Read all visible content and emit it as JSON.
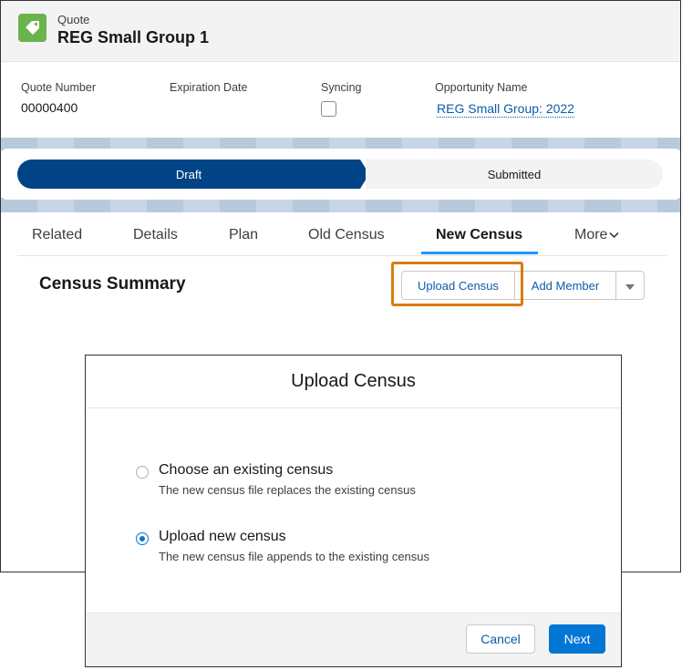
{
  "header": {
    "object_type": "Quote",
    "record_name": "REG Small Group 1",
    "icon": "price-tag-icon",
    "icon_color": "#6bb34c"
  },
  "highlights": {
    "quote_number_label": "Quote Number",
    "quote_number_value": "00000400",
    "expiration_date_label": "Expiration Date",
    "syncing_label": "Syncing",
    "syncing_checked": false,
    "opportunity_label": "Opportunity Name",
    "opportunity_value": "REG Small Group: 2022"
  },
  "path": {
    "stages": [
      "Draft",
      "Submitted"
    ],
    "active_stage": "Draft",
    "active_color": "#014486"
  },
  "tabs": {
    "items": [
      "Related",
      "Details",
      "Plan",
      "Old Census",
      "New Census",
      "More"
    ],
    "active": "New Census"
  },
  "card": {
    "title": "Census Summary",
    "upload_button": "Upload Census",
    "add_member_button": "Add Member",
    "highlight_color": "#d97b0c"
  },
  "modal": {
    "title": "Upload Census",
    "options": [
      {
        "label": "Choose an existing census",
        "help": "The new census file replaces the existing census",
        "selected": false
      },
      {
        "label": "Upload new census",
        "help": "The new census file appends to the existing census",
        "selected": true
      }
    ],
    "cancel_button": "Cancel",
    "next_button": "Next",
    "brand_color": "#0176d3"
  }
}
